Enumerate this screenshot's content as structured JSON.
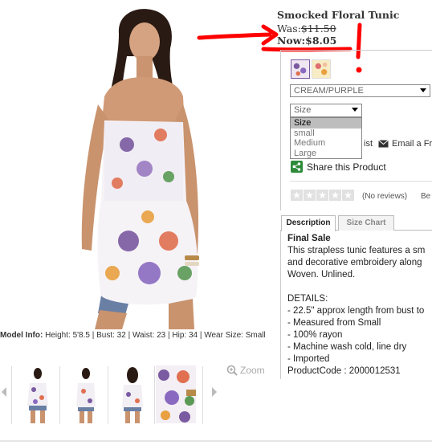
{
  "product": {
    "name": "Smocked Floral Tunic",
    "was_label": "Was:",
    "was_price": "$11.50",
    "now_label": "Now:",
    "now_price": "$8.05"
  },
  "color_select": {
    "value": "CREAM/PURPLE"
  },
  "size_select": {
    "value": "Size",
    "options": [
      "Size",
      "small",
      "Medium",
      "Large"
    ]
  },
  "actions": {
    "wishlist_tail": "ist",
    "email": "Email a Fr",
    "share": "Share this Product"
  },
  "reviews": {
    "text": "(No reviews)",
    "be": "Be"
  },
  "tabs": {
    "description": "Description",
    "size_chart": "Size Chart"
  },
  "description": {
    "final_sale": "Final Sale",
    "lines": [
      "This strapless tunic features a sm",
      "and decorative embroidery along",
      "Woven. Unlined.",
      "",
      "DETAILS:",
      "- 22.5\" approx length from bust to",
      "- Measured from Small",
      "- 100% rayon",
      "- Machine wash cold, line dry",
      "- Imported",
      "ProductCode : 2000012531"
    ]
  },
  "model_info": {
    "label": "Model Info:",
    "text": " Height: 5'8.5 | Bust: 32 | Waist: 23 | Hip: 34 | Wear Size: Small"
  },
  "zoom": {
    "label": "Zoom"
  },
  "colors": {
    "annotation_red": "#ff0000",
    "share_green": "#2e8b3a",
    "tunic_purple": "#7a5aa0"
  }
}
